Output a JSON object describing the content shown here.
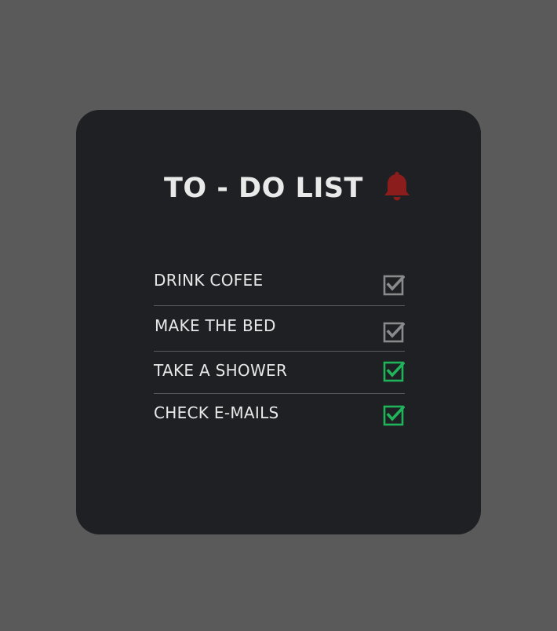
{
  "card": {
    "title": "TO - DO LIST"
  },
  "bell": {
    "icon": "bell-icon",
    "color": "#8b1d1d"
  },
  "todos": [
    {
      "label": "DRINK COFEE",
      "checked": true,
      "check_color": "#8a8a8c"
    },
    {
      "label": "MAKE THE BED",
      "checked": true,
      "check_color": "#8a8a8c"
    },
    {
      "label": "TAKE A SHOWER",
      "checked": true,
      "check_color": "#1fb45a"
    },
    {
      "label": "CHECK E-MAILS",
      "checked": true,
      "check_color": "#1fb45a"
    }
  ],
  "colors": {
    "page_background": "#5a5a5a",
    "card_background": "#1f2023",
    "text": "#e8e8e9",
    "divider": "#5b5c60"
  }
}
